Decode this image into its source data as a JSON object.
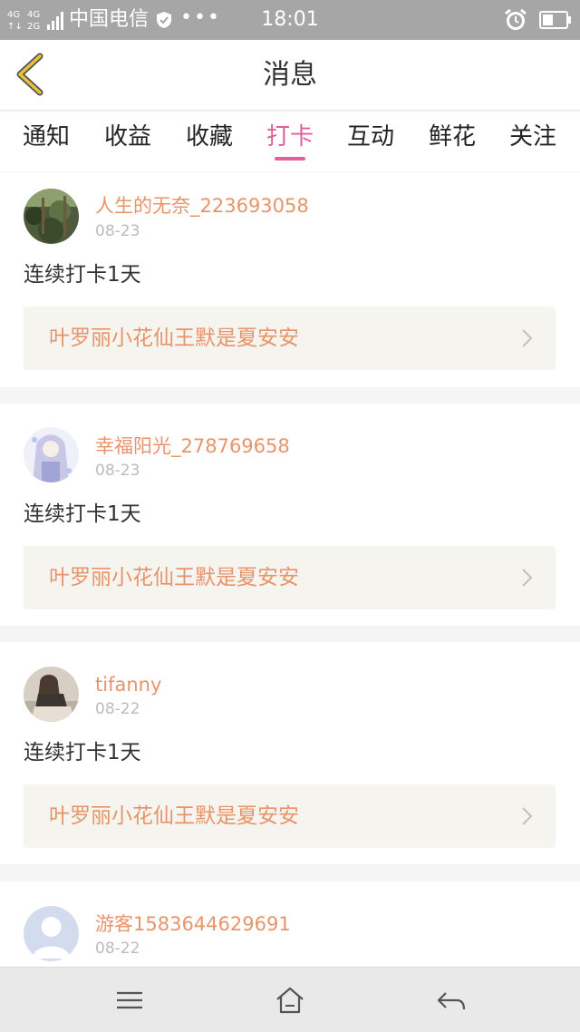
{
  "status_bar": {
    "network": "4G 4G 2G",
    "carrier": "中国电信",
    "dots": "•••",
    "time": "18:01",
    "icons": [
      "signal-icon",
      "shield-icon",
      "alarm-icon",
      "battery-icon"
    ]
  },
  "header": {
    "title": "消息",
    "back_icon": "chevron-left-icon"
  },
  "tabs": [
    {
      "label": "通知",
      "active": false
    },
    {
      "label": "收益",
      "active": false
    },
    {
      "label": "收藏",
      "active": false
    },
    {
      "label": "打卡",
      "active": true
    },
    {
      "label": "互动",
      "active": false
    },
    {
      "label": "鲜花",
      "active": false
    },
    {
      "label": "关注",
      "active": false
    }
  ],
  "messages": [
    {
      "user": "人生的无奈_223693058",
      "date": "08-23",
      "text": "连续打卡1天",
      "link": "叶罗丽小花仙王默是夏安安"
    },
    {
      "user": "幸福阳光_278769658",
      "date": "08-23",
      "text": "连续打卡1天",
      "link": "叶罗丽小花仙王默是夏安安"
    },
    {
      "user": "tifanny",
      "date": "08-22",
      "text": "连续打卡1天",
      "link": "叶罗丽小花仙王默是夏安安"
    },
    {
      "user": "游客1583644629691",
      "date": "08-22"
    }
  ],
  "bottom_bar": {
    "icons": [
      "menu-icon",
      "home-icon",
      "back-arrow-icon"
    ]
  },
  "colors": {
    "accent": "#e0609a",
    "name_orange": "#e8946a",
    "back_yellow": "#e8c23a"
  }
}
